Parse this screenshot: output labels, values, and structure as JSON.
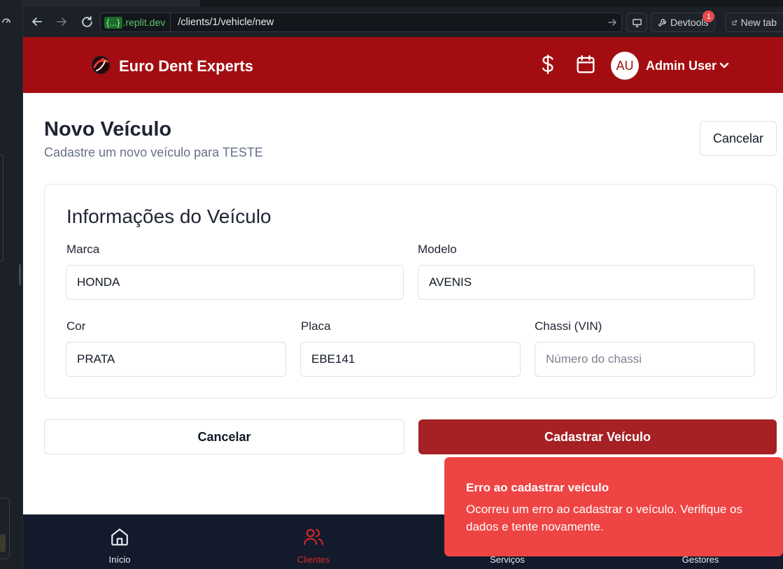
{
  "browser": {
    "url_host_badge": "{...}",
    "url_host": ".replit.dev",
    "url_path": "/clients/1/vehicle/new",
    "devtools_label": "Devtools",
    "devtools_count": "1",
    "new_tab_label": "New tab"
  },
  "header": {
    "brand": "Euro Dent Experts",
    "avatar_initials": "AU",
    "user_name": "Admin User"
  },
  "page": {
    "title": "Novo Veículo",
    "subtitle": "Cadastre um novo veículo para TESTE",
    "cancel_top": "Cancelar"
  },
  "form": {
    "title": "Informações do Veículo",
    "marca": {
      "label": "Marca",
      "value": "HONDA"
    },
    "modelo": {
      "label": "Modelo",
      "value": "AVENIS"
    },
    "cor": {
      "label": "Cor",
      "value": "PRATA"
    },
    "placa": {
      "label": "Placa",
      "value": "EBE141"
    },
    "chassi": {
      "label": "Chassi (VIN)",
      "value": "",
      "placeholder": "Número do chassi"
    },
    "cancel_label": "Cancelar",
    "submit_label": "Cadastrar Veículo"
  },
  "bottom_nav": [
    {
      "label": "Início",
      "icon": "home-icon",
      "active": false
    },
    {
      "label": "Clientes",
      "icon": "users-icon",
      "active": true
    },
    {
      "label": "Serviços",
      "icon": "wrench-icon",
      "active": false
    },
    {
      "label": "Gestores",
      "icon": "briefcase-icon",
      "active": false
    }
  ],
  "toast": {
    "title": "Erro ao cadastrar veículo",
    "body": "Ocorreu um erro ao cadastrar o veículo. Verifique os dados e tente novamente."
  },
  "colors": {
    "brand": "#a30d11",
    "primary_button": "#a52124",
    "toast_bg": "#ef4444",
    "nav_bg": "#131a2b",
    "nav_active": "#d02b2b"
  }
}
